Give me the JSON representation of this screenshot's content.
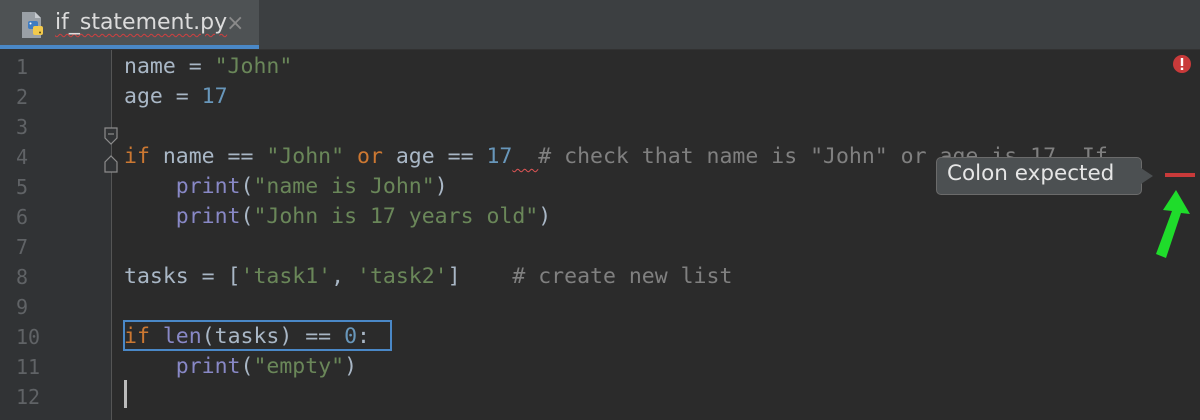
{
  "tab": {
    "filename": "if_statement.py",
    "close_glyph": "×"
  },
  "tooltip": {
    "text": "Colon expected"
  },
  "icons": {
    "file_icon": "python-file-icon",
    "error_icon": "error-stripe-icon",
    "fold_icons": [
      "fold-start-icon",
      "fold-end-icon"
    ],
    "annotation": "green-arrow-icon"
  },
  "colors": {
    "keyword": "#cc7832",
    "string": "#6a8759",
    "number": "#6897bb",
    "comment": "#808080",
    "builtin": "#8888c6",
    "identifier": "#a9b7c6",
    "error": "#c93a3a",
    "selection_box": "#4a88c7",
    "arrow": "#1fdc2b"
  },
  "line_numbers": [
    "1",
    "2",
    "3",
    "4",
    "5",
    "6",
    "7",
    "8",
    "9",
    "10",
    "11",
    "12"
  ],
  "code": {
    "l1": {
      "a": "name = ",
      "b": "\"John\""
    },
    "l2": {
      "a": "age = ",
      "b": "17"
    },
    "l4": {
      "kw1": "if",
      "a": " name == ",
      "s1": "\"John\"",
      "sp": " ",
      "kw2": "or",
      "b": " age == ",
      "n": "17",
      "gap": "  ",
      "c": "# check that name is \"John\" or age is 17. If"
    },
    "l5": {
      "indent": "    ",
      "fn": "print",
      "o": "(",
      "s": "\"name is John\"",
      "cl": ")"
    },
    "l6": {
      "indent": "    ",
      "fn": "print",
      "o": "(",
      "s": "\"John is 17 years old\"",
      "cl": ")"
    },
    "l8": {
      "a": "tasks = [",
      "s1": "'task1'",
      "c1": ", ",
      "s2": "'task2'",
      "b": "]",
      "gap": "    ",
      "c": "# create new list"
    },
    "l10": {
      "kw": "if",
      "sp": " ",
      "fn": "len",
      "a": "(tasks) == ",
      "n": "0",
      "b": ":"
    },
    "l11": {
      "indent": "    ",
      "fn": "print",
      "o": "(",
      "s": "\"empty\"",
      "cl": ")"
    }
  }
}
